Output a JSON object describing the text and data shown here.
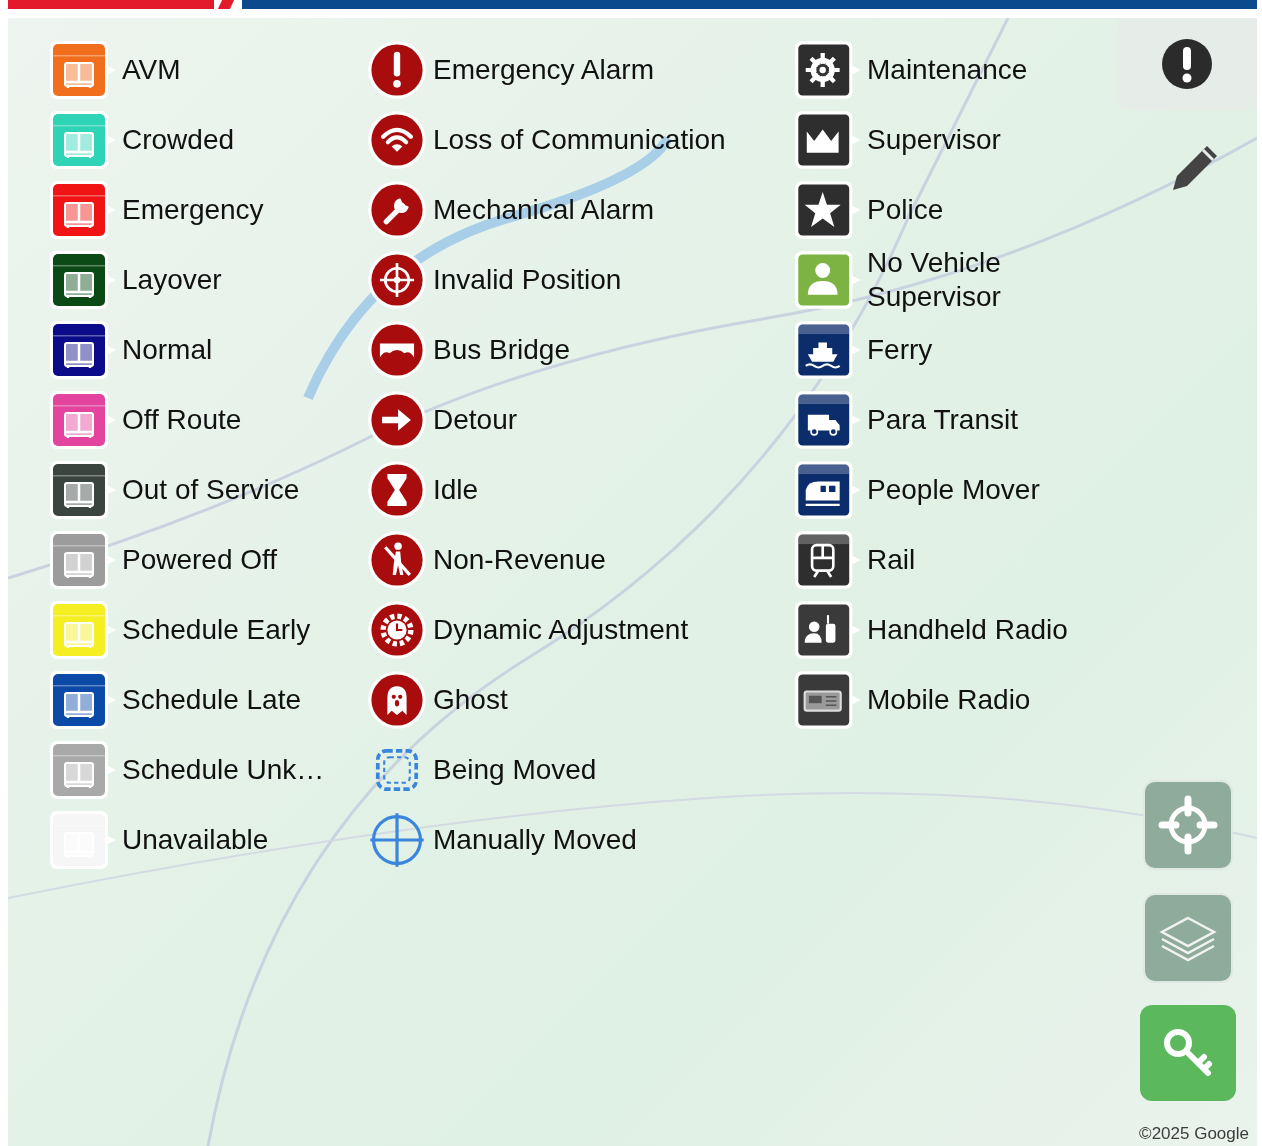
{
  "legend": {
    "columns": [
      {
        "items": [
          {
            "label": "AVM",
            "kind": "bus",
            "color": "#f06e1c"
          },
          {
            "label": "Crowded",
            "kind": "bus",
            "color": "#2fd4b6"
          },
          {
            "label": "Emergency",
            "kind": "bus",
            "color": "#f01414"
          },
          {
            "label": "Layover",
            "kind": "bus",
            "color": "#0b4a14"
          },
          {
            "label": "Normal",
            "kind": "bus",
            "color": "#0c0c8a"
          },
          {
            "label": "Off Route",
            "kind": "bus",
            "color": "#e2449e"
          },
          {
            "label": "Out of Service",
            "kind": "bus",
            "color": "#3a4540"
          },
          {
            "label": "Powered Off",
            "kind": "bus",
            "color": "#9c9c9c"
          },
          {
            "label": "Schedule Early",
            "kind": "bus",
            "color": "#f4ee22"
          },
          {
            "label": "Schedule Late",
            "kind": "bus",
            "color": "#0c4aa8"
          },
          {
            "label": "Schedule Unk…",
            "kind": "bus",
            "color": "#a9a9a9"
          },
          {
            "label": "Unavailable",
            "kind": "bus",
            "color": "#f6f6f6"
          }
        ]
      },
      {
        "items": [
          {
            "label": "Emergency Alarm",
            "kind": "exclamation"
          },
          {
            "label": "Loss of Communication",
            "kind": "wifi"
          },
          {
            "label": "Mechanical Alarm",
            "kind": "wrench"
          },
          {
            "label": "Invalid Position",
            "kind": "crosshair"
          },
          {
            "label": "Bus Bridge",
            "kind": "bridge"
          },
          {
            "label": "Detour",
            "kind": "arrow"
          },
          {
            "label": "Idle",
            "kind": "hourglass"
          },
          {
            "label": "Non-Revenue",
            "kind": "walker"
          },
          {
            "label": "Dynamic Adjustment",
            "kind": "clock"
          },
          {
            "label": "Ghost",
            "kind": "ghost"
          },
          {
            "label": "Being Moved",
            "kind": "dashed"
          },
          {
            "label": "Manually Moved",
            "kind": "target"
          }
        ]
      },
      {
        "items": [
          {
            "label": "Maintenance",
            "kind": "gear"
          },
          {
            "label": "Supervisor",
            "kind": "crown"
          },
          {
            "label": "Police",
            "kind": "star"
          },
          {
            "label": "No Vehicle Supervisor",
            "kind": "person"
          },
          {
            "label": "Ferry",
            "kind": "ferry"
          },
          {
            "label": "Para Transit",
            "kind": "van"
          },
          {
            "label": "People Mover",
            "kind": "tram"
          },
          {
            "label": "Rail",
            "kind": "train"
          },
          {
            "label": "Handheld Radio",
            "kind": "handheld"
          },
          {
            "label": "Mobile Radio",
            "kind": "radio"
          }
        ]
      }
    ]
  },
  "attribution": "©2025 Google"
}
